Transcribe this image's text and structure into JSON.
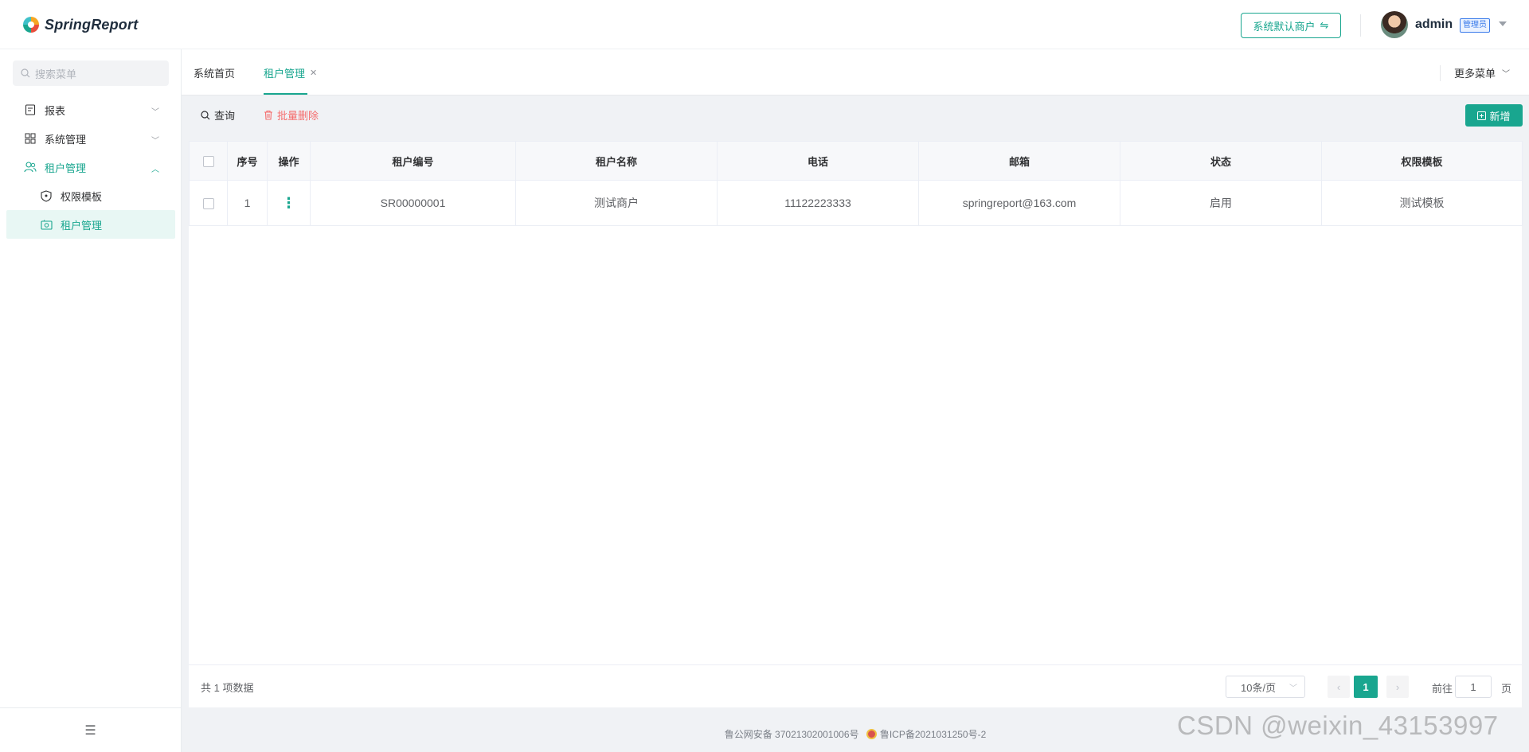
{
  "brand": {
    "name": "SpringReport"
  },
  "header": {
    "tenant_button": "系统默认商户",
    "tenant_switch_icon": "switch-icon",
    "user_name": "admin",
    "role_badge": "管理员"
  },
  "sidebar": {
    "search_placeholder": "搜索菜单",
    "items": [
      {
        "label": "报表",
        "icon": "report-icon",
        "expanded": false
      },
      {
        "label": "系统管理",
        "icon": "grid-icon",
        "expanded": false
      },
      {
        "label": "租户管理",
        "icon": "users-icon",
        "expanded": true
      }
    ],
    "subitems": [
      {
        "label": "权限模板",
        "icon": "shield-icon",
        "active": false
      },
      {
        "label": "租户管理",
        "icon": "tenant-icon",
        "active": true
      }
    ]
  },
  "tabs": {
    "items": [
      {
        "label": "系统首页",
        "active": false
      },
      {
        "label": "租户管理",
        "active": true
      }
    ],
    "more_menu": "更多菜单"
  },
  "toolbar": {
    "query_label": "查询",
    "batch_delete_label": "批量删除",
    "add_label": "新增"
  },
  "table": {
    "columns": [
      "序号",
      "操作",
      "租户编号",
      "租户名称",
      "电话",
      "邮箱",
      "状态",
      "权限模板"
    ],
    "rows": [
      {
        "index": "1",
        "action": "⋮",
        "tenant_code": "SR00000001",
        "tenant_name": "测试商户",
        "phone": "11122223333",
        "email": "springreport@163.com",
        "status": "启用",
        "template": "测试模板"
      }
    ]
  },
  "pagination": {
    "total_text": "共 1 项数据",
    "page_size": "10条/页",
    "current_page": "1",
    "goto_label": "前往",
    "goto_value": "1",
    "goto_suffix": "页"
  },
  "footer": {
    "police_record": "鲁公网安备 37021302001006号",
    "icp_record": "鲁ICP备2021031250号-2"
  },
  "watermark": "CSDN @weixin_43153997",
  "colors": {
    "accent": "#19a68f",
    "danger": "#f56c6c",
    "badge": "#3a7bea"
  }
}
